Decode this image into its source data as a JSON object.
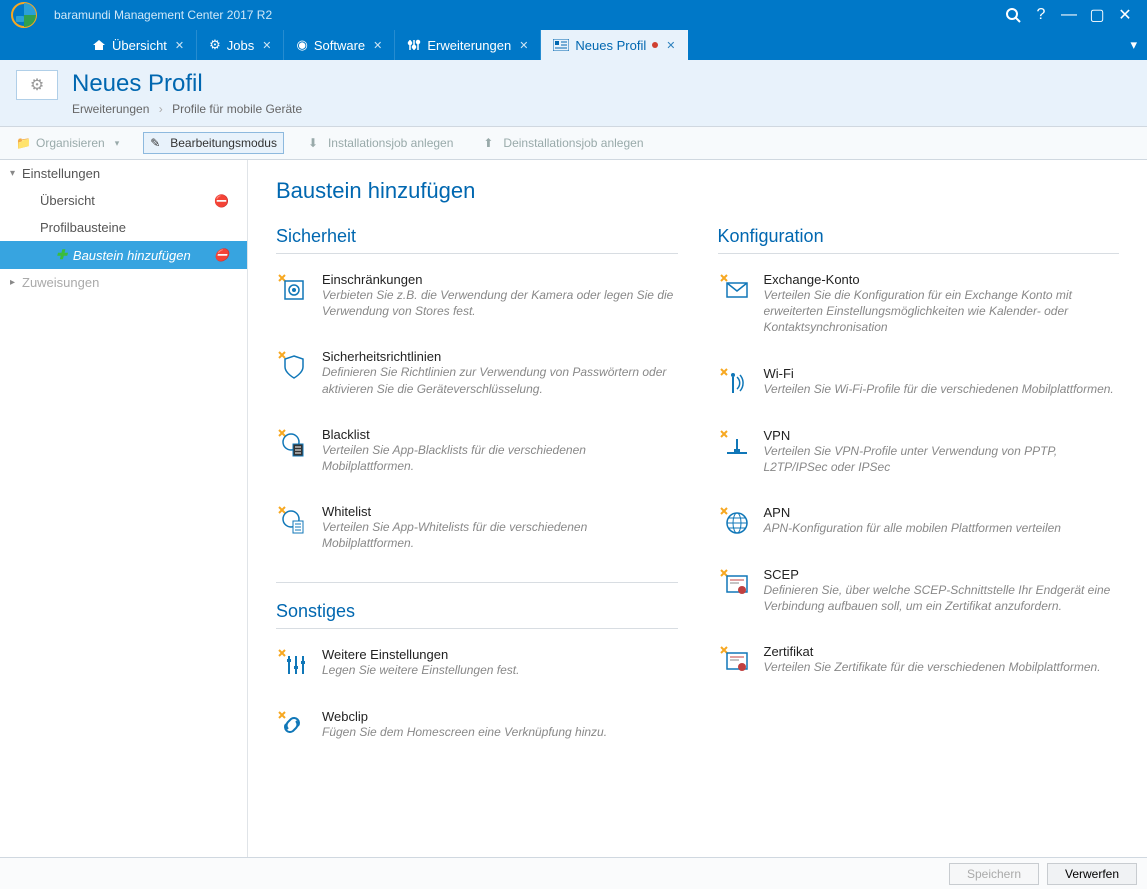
{
  "app": {
    "title": "baramundi Management Center 2017 R2"
  },
  "tabs": [
    {
      "label": "Übersicht",
      "active": false
    },
    {
      "label": "Jobs",
      "active": false
    },
    {
      "label": "Software",
      "active": false
    },
    {
      "label": "Erweiterungen",
      "active": false
    },
    {
      "label": "Neues Profil",
      "active": true,
      "dirty": true
    }
  ],
  "header": {
    "title": "Neues Profil",
    "breadcrumb": [
      "Erweiterungen",
      "Profile für mobile Geräte"
    ]
  },
  "toolbar": {
    "organize": "Organisieren",
    "editmode": "Bearbeitungsmodus",
    "installjob": "Installationsjob anlegen",
    "uninstalljob": "Deinstallationsjob anlegen"
  },
  "sidebar": {
    "settings": "Einstellungen",
    "overview": "Übersicht",
    "modules": "Profilbausteine",
    "addmodule": "Baustein hinzufügen",
    "assignments": "Zuweisungen"
  },
  "content": {
    "heading": "Baustein hinzufügen",
    "sec_heading": "Sicherheit",
    "conf_heading": "Konfiguration",
    "other_heading": "Sonstiges",
    "security": [
      {
        "title": "Einschränkungen",
        "desc": "Verbieten Sie z.B. die Verwendung der Kamera oder legen Sie die Verwendung von Stores fest."
      },
      {
        "title": "Sicherheitsrichtlinien",
        "desc": "Definieren Sie Richtlinien zur Verwendung von Passwörtern oder aktivieren Sie die Geräteverschlüsselung."
      },
      {
        "title": "Blacklist",
        "desc": "Verteilen Sie App-Blacklists für die verschiedenen Mobilplattformen."
      },
      {
        "title": "Whitelist",
        "desc": "Verteilen Sie App-Whitelists für die verschiedenen Mobilplattformen."
      }
    ],
    "config": [
      {
        "title": "Exchange-Konto",
        "desc": "Verteilen Sie die Konfiguration für ein Exchange Konto mit erweiterten Einstellungsmöglichkeiten wie Kalender- oder Kontaktsynchronisation"
      },
      {
        "title": "Wi-Fi",
        "desc": "Verteilen Sie Wi-Fi-Profile für die verschiedenen Mobilplattformen."
      },
      {
        "title": "VPN",
        "desc": "Verteilen Sie VPN-Profile unter Verwendung von PPTP, L2TP/IPSec oder IPSec"
      },
      {
        "title": "APN",
        "desc": "APN-Konfiguration für alle mobilen Plattformen verteilen"
      },
      {
        "title": "SCEP",
        "desc": "Definieren Sie, über welche SCEP-Schnittstelle Ihr Endgerät eine Verbindung aufbauen soll, um ein Zertifikat anzufordern."
      },
      {
        "title": "Zertifikat",
        "desc": "Verteilen Sie Zertifikate für die verschiedenen Mobilplattformen."
      }
    ],
    "other": [
      {
        "title": "Weitere Einstellungen",
        "desc": "Legen Sie weitere Einstellungen fest."
      },
      {
        "title": "Webclip",
        "desc": "Fügen Sie dem Homescreen eine Verknüpfung hinzu."
      }
    ]
  },
  "footer": {
    "save": "Speichern",
    "discard": "Verwerfen"
  }
}
